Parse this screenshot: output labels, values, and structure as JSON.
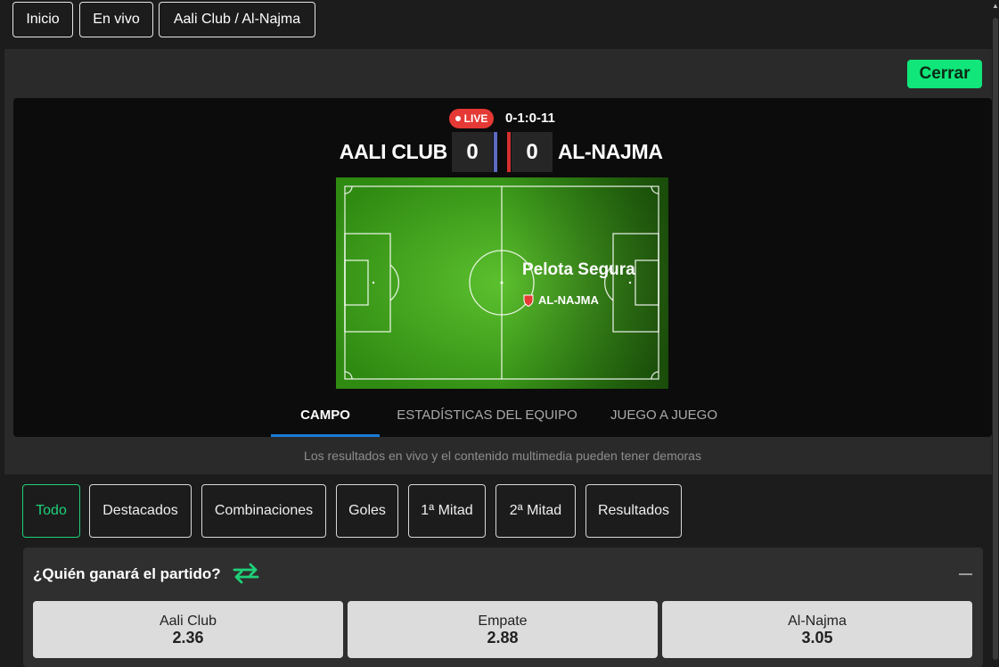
{
  "breadcrumbs": [
    "Inicio",
    "En vivo",
    "Aali Club / Al-Najma"
  ],
  "close_label": "Cerrar",
  "match": {
    "live_label": "LIVE",
    "clock": "0-1:0-11",
    "home_team": "AALI CLUB",
    "away_team": "AL-NAJMA",
    "home_score": "0",
    "away_score": "0",
    "home_color": "#5c6bc0",
    "away_color": "#d32f2f",
    "pitch_event": "Pelota Segura",
    "pitch_team": "AL-NAJMA"
  },
  "tabs": [
    "CAMPO",
    "ESTADÍSTICAS DEL EQUIPO",
    "JUEGO A JUEGO"
  ],
  "active_tab": "CAMPO",
  "disclaimer": "Los resultados en vivo y el contenido multimedia pueden tener demoras",
  "filters": [
    "Todo",
    "Destacados",
    "Combinaciones",
    "Goles",
    "1ª Mitad",
    "2ª Mitad",
    "Resultados"
  ],
  "active_filter": "Todo",
  "market": {
    "title": "¿Quién ganará el partido?",
    "options": [
      {
        "label": "Aali Club",
        "odds": "2.36"
      },
      {
        "label": "Empate",
        "odds": "2.88"
      },
      {
        "label": "Al-Najma",
        "odds": "3.05"
      }
    ]
  },
  "colors": {
    "accent": "#11e67a",
    "live": "#e53935",
    "tab_underline": "#1a7bd6"
  }
}
